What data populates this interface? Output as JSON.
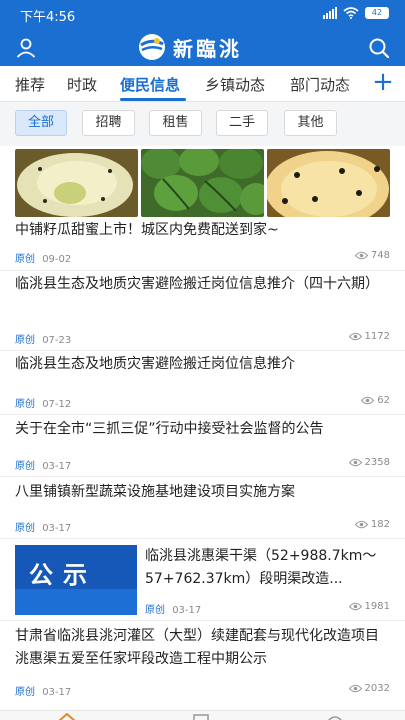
{
  "status_bar": {
    "time": "下午4:56",
    "battery": "42"
  },
  "header": {
    "brand_name": "新臨洮"
  },
  "tabs": {
    "items": [
      {
        "label": "推荐"
      },
      {
        "label": "时政"
      },
      {
        "label": "便民信息"
      },
      {
        "label": "乡镇动态"
      },
      {
        "label": "部门动态"
      }
    ],
    "active": "便民信息",
    "add_label": "+"
  },
  "filters": {
    "items": [
      {
        "label": "全部"
      },
      {
        "label": "招聘"
      },
      {
        "label": "租售"
      },
      {
        "label": "二手"
      },
      {
        "label": "其他"
      }
    ],
    "active": "全部"
  },
  "feed": {
    "items": [
      {
        "title": "中铺籽瓜甜蜜上市！城区内免费配送到家~",
        "source": "原创",
        "date": "09-02",
        "views": "748"
      },
      {
        "title": "临洮县生态及地质灾害避险搬迁岗位信息推介（四十六期）",
        "source": "原创",
        "date": "07-23",
        "views": "1172"
      },
      {
        "title": "临洮县生态及地质灾害避险搬迁岗位信息推介",
        "source": "原创",
        "date": "07-12",
        "views": "62"
      },
      {
        "title": "关于在全市“三抓三促”行动中接受社会监督的公告",
        "source": "原创",
        "date": "03-17",
        "views": "2358"
      },
      {
        "title": "八里铺镇新型蔬菜设施基地建设项目实施方案",
        "source": "原创",
        "date": "03-17",
        "views": "182"
      },
      {
        "title": "临洮县洮惠渠干渠（52+988.7km～57+762.37km）段明渠改造...",
        "thumb_text": "公示",
        "source": "原创",
        "date": "03-17",
        "views": "1981"
      },
      {
        "title": "甘肃省临洮县洮河灌区（大型）续建配套与现代化改造项目洮惠渠五爱至任家坪段改造工程中期公示",
        "source": "原创",
        "date": "03-17",
        "views": "2032"
      }
    ]
  },
  "colors": {
    "brand": "#1a6fd1",
    "chip_active_bg": "#d9e8fb",
    "meta_gray": "#8a8a8a"
  }
}
